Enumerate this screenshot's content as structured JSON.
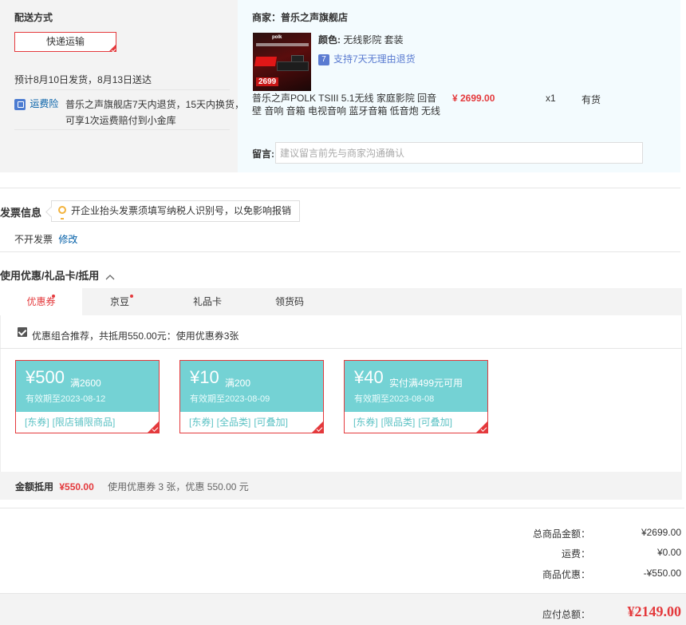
{
  "shipping": {
    "title": "配送方式",
    "method_label": "快递运输",
    "estimate": "预计8月10日发货，8月13日送达",
    "insurance_label": "运费险",
    "insurance_text_1": "普乐之声旗舰店7天内退货，15天内换货，",
    "insurance_text_2": "可享1次运费赔付到小金库"
  },
  "shop": {
    "merchant_label": "商家：",
    "merchant_name": "普乐之声旗舰店",
    "product": {
      "image_logo": "polk",
      "image_price": "2699",
      "color_label": "颜色:",
      "color_value": "无线影院 套装",
      "return_label": "支持7天无理由退货",
      "return_icon_text": "7",
      "title_line1": "普乐之声POLK TSIII 5.1无线 家庭影院 回音",
      "title_line2": "壁 音响 音箱 电视音响 蓝牙音箱 低音炮 无线",
      "price": "¥ 2699.00",
      "quantity": "x1",
      "stock": "有货"
    },
    "note_label": "留言:",
    "note_placeholder": "建议留言前先与商家沟通确认"
  },
  "invoice": {
    "title": "发票信息",
    "tip": "开企业抬头发票须填写纳税人识别号，以免影响报销",
    "current": "不开发票",
    "edit_label": "修改"
  },
  "coupons": {
    "title": "使用优惠/礼品卡/抵用",
    "tabs": [
      {
        "label": "优惠券"
      },
      {
        "label": "京豆"
      },
      {
        "label": "礼品卡"
      },
      {
        "label": "领货码"
      }
    ],
    "recommend_text": "优惠组合推荐，共抵用550.00元：使用优惠券3张",
    "items": [
      {
        "amount": "¥500",
        "condition": "满2600",
        "expiry": "有效期至2023-08-12",
        "tag1": "[东券]",
        "tag2": "[限店铺限商品]",
        "tag3": ""
      },
      {
        "amount": "¥10",
        "condition": "满200",
        "expiry": "有效期至2023-08-09",
        "tag1": "[东券]",
        "tag2": "[全品类]",
        "tag3": "[可叠加]"
      },
      {
        "amount": "¥40",
        "condition": "实付满499元可用",
        "expiry": "有效期至2023-08-08",
        "tag1": "[东券]",
        "tag2": "[限品类]",
        "tag3": "[可叠加]"
      }
    ],
    "deduct_label": "金额抵用",
    "deduct_amount": "¥550.00",
    "deduct_detail": "使用优惠券 3 张，优惠 550.00 元"
  },
  "summary": {
    "goods_label": "总商品金额：",
    "goods_value": "¥2699.00",
    "shipping_label": "运费：",
    "shipping_value": "¥0.00",
    "discount_label": "商品优惠：",
    "discount_value": "-¥550.00",
    "total_label": "应付总额：",
    "total_value": "¥2149.00"
  },
  "colors": {
    "accent": "#e4393c",
    "coupon": "#74d2d4",
    "link": "#005ea7"
  }
}
